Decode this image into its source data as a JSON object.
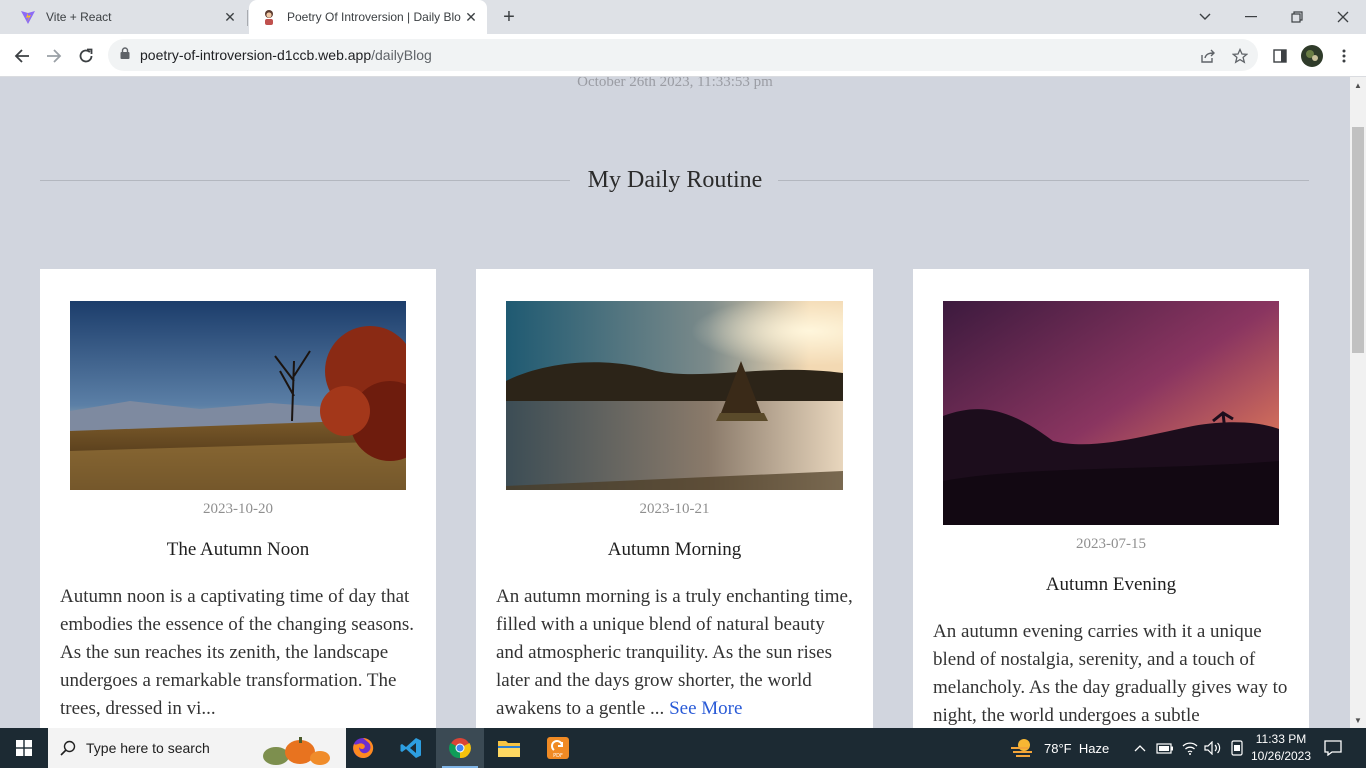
{
  "browser": {
    "tabs": [
      {
        "title": "Vite + React",
        "icon": "vite-icon"
      },
      {
        "title": "Poetry Of Introversion | Daily Blo",
        "icon": "poetry-avatar-icon"
      }
    ],
    "url_host": "poetry-of-introversion-d1ccb.web.app",
    "url_path": "/dailyBlog"
  },
  "page": {
    "timestamp": "October 26th 2023, 11:33:53 pm",
    "section_title": "My Daily Routine",
    "cards": [
      {
        "date": "2023-10-20",
        "title": "The Autumn Noon",
        "body": "Autumn noon is a captivating time of day that embodies the essence of the changing seasons. As the sun reaches its zenith, the landscape undergoes a remarkable transformation. The trees, dressed in vi...",
        "see_more": ""
      },
      {
        "date": "2023-10-21",
        "title": "Autumn Morning",
        "body": "An autumn morning is a truly enchanting time, filled with a unique blend of natural beauty and atmospheric tranquility. As the sun rises later and the days grow shorter, the world awakens to a gentle ... ",
        "see_more": "See More"
      },
      {
        "date": "2023-07-15",
        "title": "Autumn Evening",
        "body": "An autumn evening carries with it a unique blend of nostalgia, serenity, and a touch of melancholy. As the day gradually gives way to night, the world undergoes a subtle",
        "see_more": ""
      }
    ]
  },
  "taskbar": {
    "search_placeholder": "Type here to search",
    "weather": "78°F  Haze",
    "time": "11:33 PM",
    "date": "10/26/2023"
  }
}
